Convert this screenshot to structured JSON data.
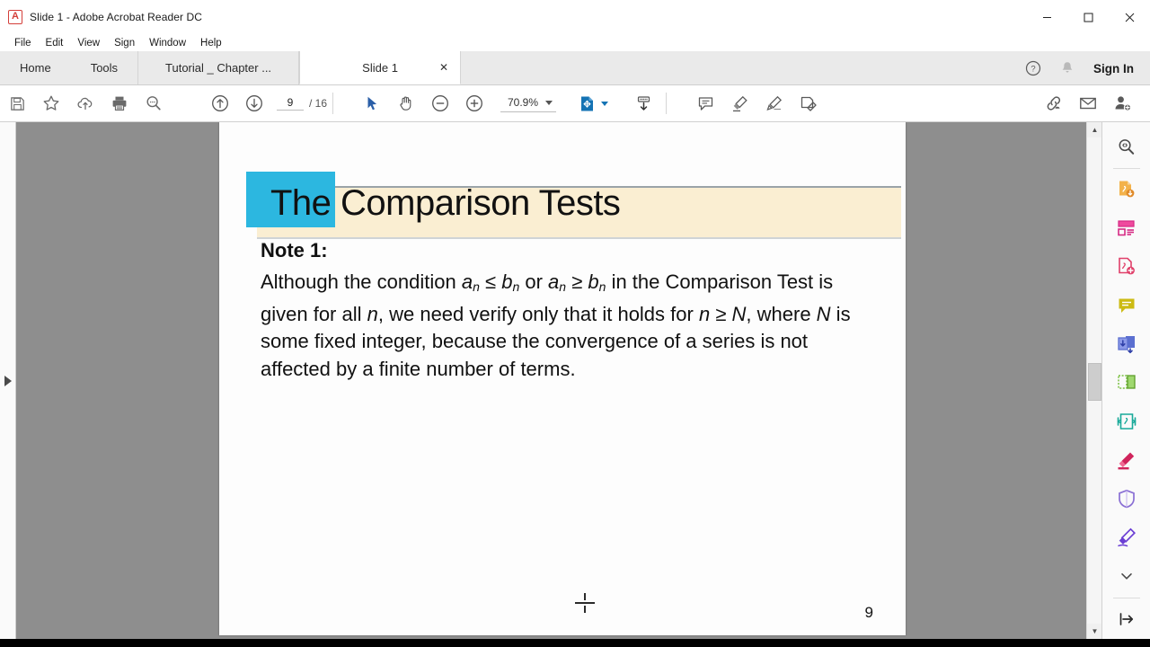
{
  "window": {
    "title": "Slide 1 - Adobe Acrobat Reader DC",
    "app_icon": "A",
    "controls": {
      "minimize": "–",
      "maximize": "☐",
      "close": "✕"
    }
  },
  "menubar": {
    "items": [
      "File",
      "Edit",
      "View",
      "Sign",
      "Window",
      "Help"
    ]
  },
  "tabstrip": {
    "nav": [
      "Home",
      "Tools"
    ],
    "tabs": [
      {
        "label": "Tutorial _ Chapter ...",
        "active": false,
        "closable": false
      },
      {
        "label": "Slide 1",
        "active": true,
        "closable": true,
        "close_glyph": "✕"
      }
    ],
    "help_icon": "question-circle-icon",
    "bell_icon": "bell-icon",
    "signin_label": "Sign In"
  },
  "toolbar": {
    "icons_left": [
      "save-icon",
      "star-icon",
      "upload-cloud-icon",
      "print-icon",
      "search-icon"
    ],
    "page_prev_icon": "arrow-up-circle-icon",
    "page_next_icon": "arrow-down-circle-icon",
    "page_current": "9",
    "page_total": "/ 16",
    "select_tool_icon": "cursor-arrow-icon",
    "hand_tool_icon": "hand-icon",
    "zoom_out_icon": "minus-circle-icon",
    "zoom_in_icon": "plus-circle-icon",
    "zoom_value": "70.9%",
    "fit_page_icon": "fit-page-icon",
    "scroll_mode_icon": "scroll-mode-icon",
    "comment_icon": "comment-icon",
    "highlight_icon": "highlighter-icon",
    "draw_icon": "pen-draw-icon",
    "sign_icon": "fill-and-sign-icon",
    "share_link_icon": "share-link-icon",
    "email_icon": "email-icon",
    "add_person_icon": "add-person-icon"
  },
  "slide": {
    "title": "The Comparison Tests",
    "note_label": "Note 1:",
    "note_text_html": "Although the condition <i>a</i><sub>n</sub> ≤ <i>b</i><sub>n</sub> or <i>a</i><sub>n</sub> ≥ <i>b</i><sub>n</sub> in the Comparison Test is given for all <i>n</i>, we need verify only that it holds for <i>n</i> ≥ <i>N</i>, where <i>N</i> is some fixed integer, because the convergence of a series is not affected by a finite number of terms.",
    "page_number": "9",
    "accent_color": "#2cb7e0",
    "banner_color": "#faeed2"
  },
  "right_rail": {
    "items": [
      {
        "name": "search-document-icon",
        "color": "#4a4a4a"
      },
      {
        "name": "export-pdf-icon",
        "color": "#e8a33d"
      },
      {
        "name": "organize-pages-icon",
        "color": "#e3338c"
      },
      {
        "name": "create-pdf-icon",
        "color": "#e0406a"
      },
      {
        "name": "comment-tool-icon",
        "color": "#c8b400"
      },
      {
        "name": "combine-files-icon",
        "color": "#5b6fd0"
      },
      {
        "name": "edit-pdf-icon",
        "color": "#7bc043"
      },
      {
        "name": "compress-pdf-icon",
        "color": "#18a999"
      },
      {
        "name": "redact-icon",
        "color": "#d0245c"
      },
      {
        "name": "protect-icon",
        "color": "#8a6fd4"
      },
      {
        "name": "fill-sign-icon",
        "color": "#6b3fd4"
      },
      {
        "name": "more-tools-chevron-icon",
        "color": "#4a4a4a"
      },
      {
        "name": "collapse-panel-icon",
        "color": "#2b2b2b"
      }
    ]
  },
  "scrollbar": {
    "up_glyph": "▲",
    "down_glyph": "▼"
  }
}
